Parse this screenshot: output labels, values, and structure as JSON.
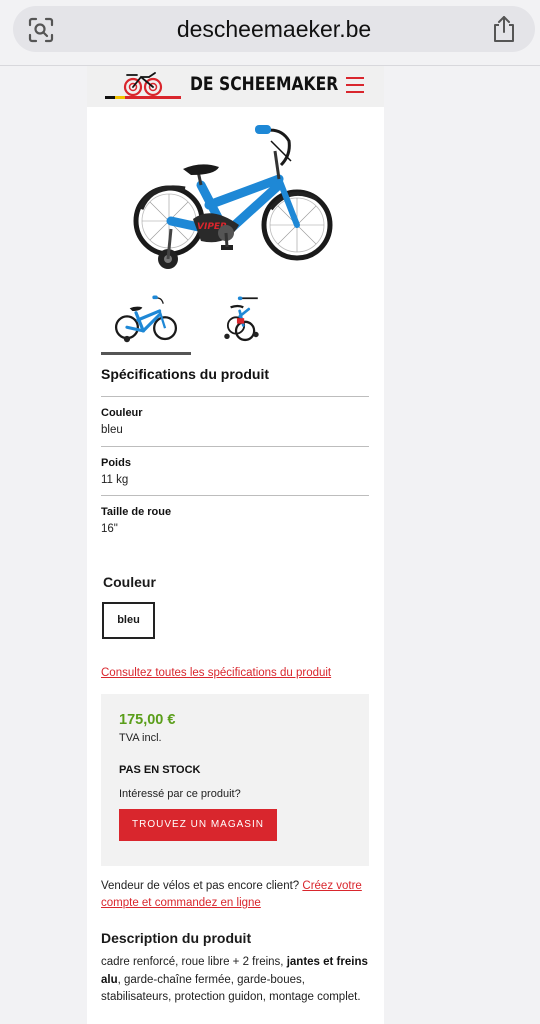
{
  "browser": {
    "url": "descheemaeker.be"
  },
  "header": {
    "brand": "DE SCHEEMAKER"
  },
  "product": {
    "specs_title": "Spécifications du produit",
    "specs": [
      {
        "label": "Couleur",
        "value": "bleu"
      },
      {
        "label": "Poids",
        "value": "11 kg"
      },
      {
        "label": "Taille de roue",
        "value": "16\""
      }
    ],
    "color_title": "Couleur",
    "color_option": "bleu",
    "all_specs_link": "Consultez toutes les spécifications du produit",
    "price": "175,00 €",
    "vat": "TVA incl.",
    "stock_status": "PAS EN STOCK",
    "interest_text": "Intéressé par ce produit?",
    "store_button": "TROUVEZ UN MAGASIN",
    "vendor_text": "Vendeur de vélos et pas encore client? ",
    "vendor_link": "Créez votre compte et commandez en ligne",
    "desc_title": "Description du produit",
    "desc_part1": "cadre renforcé, roue libre + 2 freins, ",
    "desc_bold": "jantes et freins alu",
    "desc_part2": ", garde-chaîne fermée, garde-boues, stabilisateurs, protection guidon, montage complet.",
    "bike_label": "VIPER"
  },
  "colors": {
    "accent_red": "#d9262d",
    "price_green": "#5a9e1a",
    "bike_blue": "#1e88d6"
  }
}
